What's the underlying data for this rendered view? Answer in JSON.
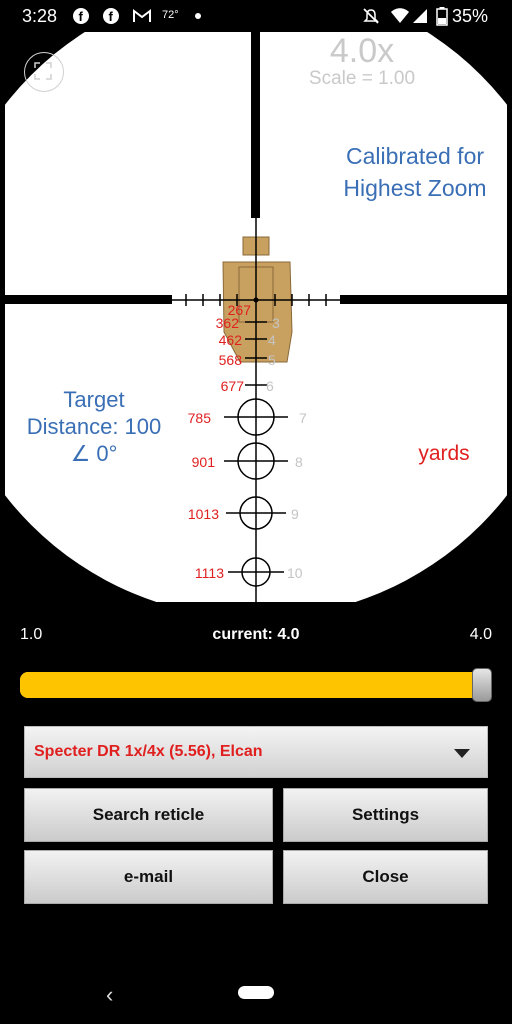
{
  "status_bar": {
    "time": "3:28",
    "temperature": "72°",
    "battery": "35%",
    "icons": [
      "facebook-icon",
      "facebook-icon",
      "gmail-icon",
      "dot-icon",
      "silent-icon",
      "wifi-icon",
      "signal-icon",
      "battery-icon"
    ]
  },
  "reticle": {
    "zoom": "4.0x",
    "scale": "Scale = 1.00",
    "calibration_line1": "Calibrated for",
    "calibration_line2": "Highest Zoom",
    "target_line1": "Target",
    "target_line2": "Distance: 100",
    "target_line3": "∠ 0°",
    "unit": "yards",
    "drop_marks": [
      {
        "range": "267",
        "number": "3"
      },
      {
        "range": "362",
        "number": "3"
      },
      {
        "range": "462",
        "number": "4"
      },
      {
        "range": "568",
        "number": "5"
      },
      {
        "range": "677",
        "number": "6"
      },
      {
        "range": "785",
        "number": "7"
      },
      {
        "range": "901",
        "number": "8"
      },
      {
        "range": "1013",
        "number": "9"
      },
      {
        "range": "1113",
        "number": "10"
      }
    ]
  },
  "zoom_slider": {
    "min_label": "1.0",
    "current_label": "current: 4.0",
    "max_label": "4.0",
    "value": 1.0
  },
  "reticle_select": {
    "selected": "Specter DR 1x/4x (5.56), Elcan"
  },
  "buttons": {
    "search": "Search reticle",
    "settings": "Settings",
    "email": "e-mail",
    "close": "Close"
  },
  "colors": {
    "accent_blue": "#3a6fb5",
    "accent_red": "#e01f1f",
    "slider": "#ffc400",
    "target": "#c8a060"
  }
}
